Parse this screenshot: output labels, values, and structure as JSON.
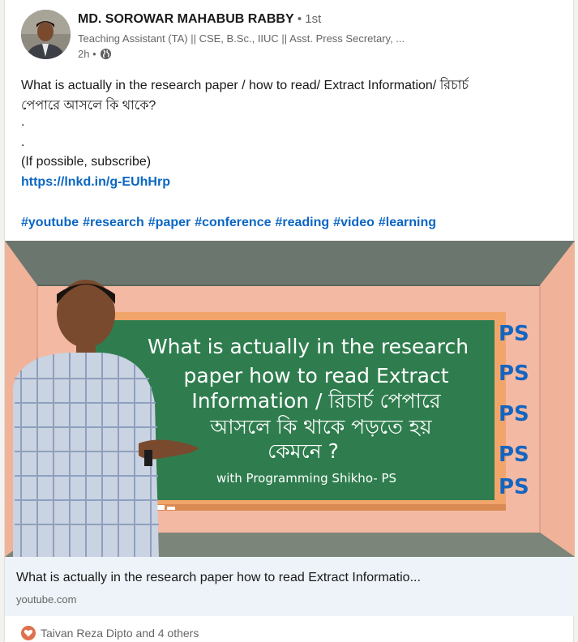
{
  "post": {
    "author_name": "MD. SOROWAR MAHABUB RABBY",
    "degree": " • 1st",
    "headline": "Teaching Assistant (TA) || CSE, B.Sc., IIUC || Asst. Press Secretary, ...",
    "time": "2h •",
    "lines": [
      "What is actually in the research paper / how to read/ Extract Information/ রিচার্চ",
      "পেপারে আসলে কি থাকে?",
      ".",
      ".",
      "(If possible, subscribe)"
    ],
    "link_text": "https://lnkd.in/g-EUhHrp",
    "hashtags": [
      "#youtube",
      "#research",
      "#paper",
      "#conference",
      "#reading",
      "#video",
      "#learning"
    ]
  },
  "thumbnail": {
    "board_lines": [
      "What is actually in the research",
      "paper  how to read Extract",
      "Information / রিচার্চ পেপারে",
      "আসলে কি থাকে পড়তে হয়",
      "কেমনে ?"
    ],
    "board_credit": "with Programming Shikho- PS",
    "logo_text": "PS",
    "logo_color": "#1565c0"
  },
  "preview": {
    "title": "What is actually in the research paper how to read Extract Informatio...",
    "domain": "youtube.com"
  },
  "reactions": {
    "text": "Taivan Reza Dipto and 4 others",
    "icon": "heart-icon"
  },
  "colors": {
    "link": "#0a66c2",
    "board": "#2f7d4e",
    "board_frame": "#f2a56b",
    "wall": "#f4b9a2",
    "ceiling": "#6e7a70"
  }
}
